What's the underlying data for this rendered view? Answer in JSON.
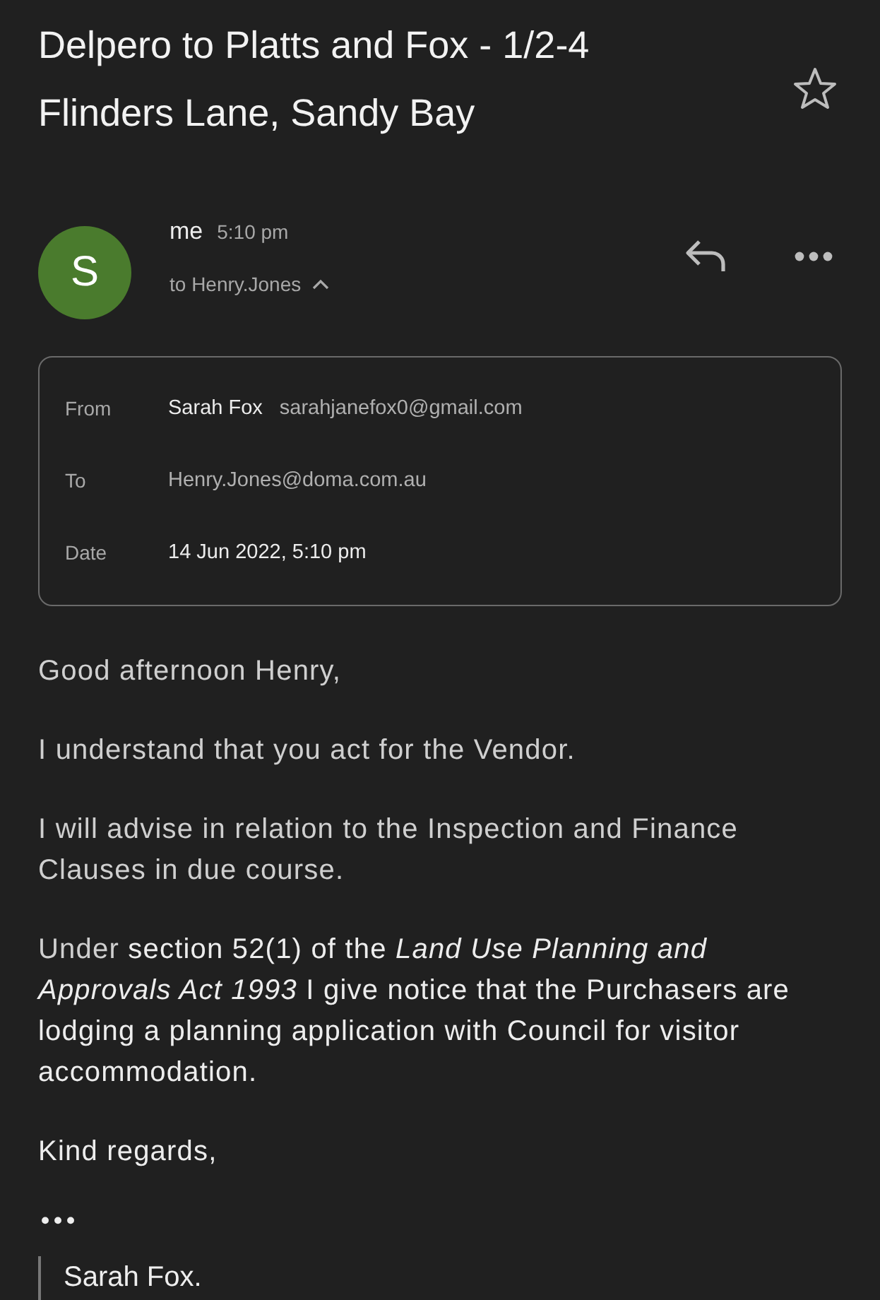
{
  "subject": {
    "title": "Delpero to Platts and Fox - 1/2-4 Flinders Lane, Sandy Bay",
    "starred": false
  },
  "message": {
    "avatar_letter": "S",
    "sender": "me",
    "time": "5:10 pm",
    "recipients": "to Henry.Jones",
    "details_expanded": true
  },
  "details": [
    {
      "label": "From",
      "name": "Sarah Fox",
      "value": "sarahjanefox0@gmail.com"
    },
    {
      "label": "To",
      "value": "Henry.Jones@doma.com.au"
    },
    {
      "label": "Date",
      "name": "14 Jun 2022, 5:10 pm"
    }
  ],
  "body": [
    {
      "runs": [
        {
          "kind": "dim",
          "text": "Good afternoon Henry,"
        }
      ]
    },
    {
      "runs": [
        {
          "kind": "dim",
          "text": "I understand that you act for the Vendor."
        }
      ]
    },
    {
      "runs": [
        {
          "kind": "dim",
          "text": "I will advise in relation to the Inspection and Finance Clauses in due course."
        }
      ]
    },
    {
      "runs": [
        {
          "kind": "dim",
          "text": "Under "
        },
        {
          "kind": "plain",
          "text": "section 52(1) of the "
        },
        {
          "kind": "italic",
          "text": "Land Use Planning and Approvals Act 1993"
        },
        {
          "kind": "plain",
          "text": " I give notice that the Purchasers are lodging a planning application with Council for visitor accommodation."
        }
      ]
    },
    {
      "runs": [
        {
          "kind": "plain",
          "text": "Kind regards,"
        }
      ]
    }
  ],
  "quoted": {
    "toggle": "•••",
    "signature": "Sarah Fox."
  }
}
